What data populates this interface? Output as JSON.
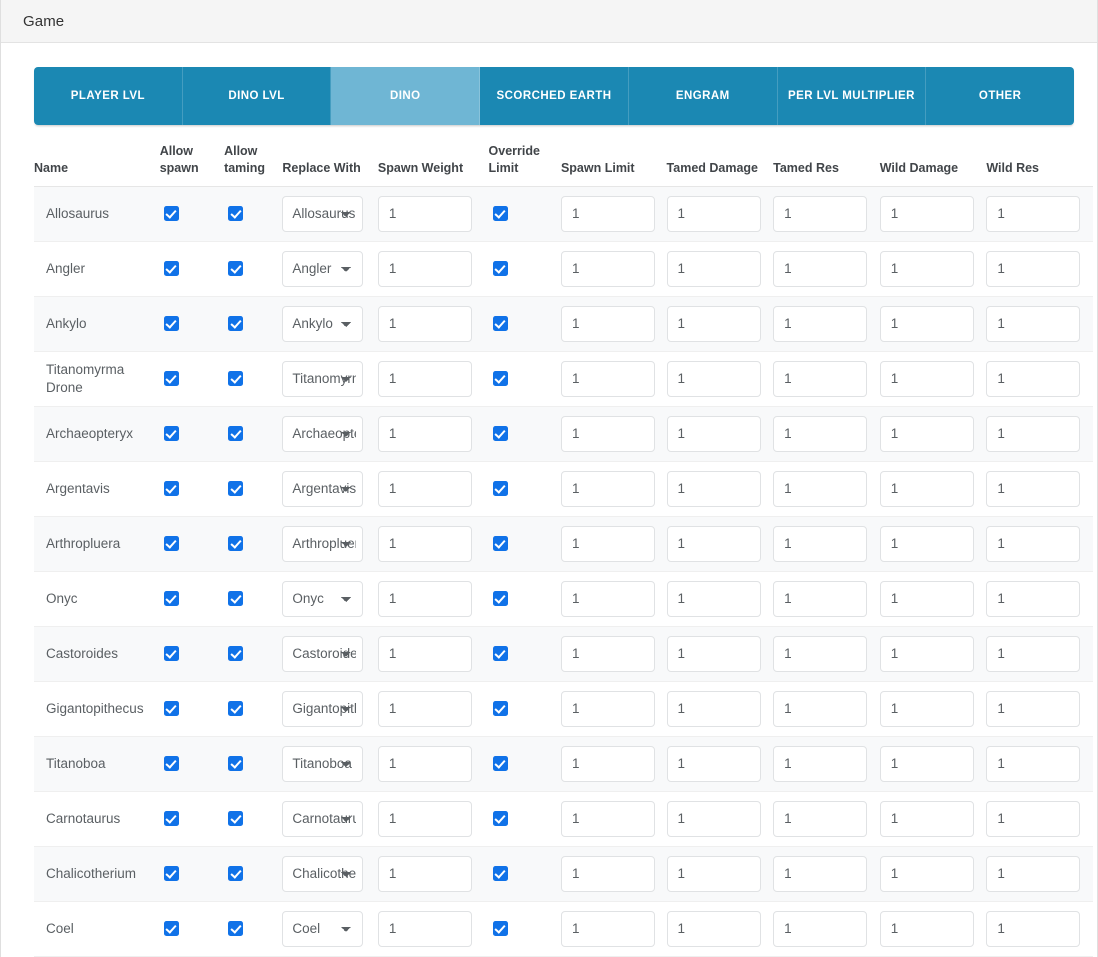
{
  "header": {
    "title": "Game"
  },
  "tabs": [
    {
      "label": "PLAYER LVL",
      "active": false
    },
    {
      "label": "DINO LVL",
      "active": false
    },
    {
      "label": "DINO",
      "active": true
    },
    {
      "label": "SCORCHED EARTH",
      "active": false
    },
    {
      "label": "ENGRAM",
      "active": false
    },
    {
      "label": "PER LVL MULTIPLIER",
      "active": false
    },
    {
      "label": "OTHER",
      "active": false
    }
  ],
  "table": {
    "columns": [
      "Name",
      "Allow spawn",
      "Allow taming",
      "Replace With",
      "Spawn Weight",
      "Override Limit",
      "Spawn Limit",
      "Tamed Damage",
      "Tamed Res",
      "Wild Damage",
      "Wild Res"
    ],
    "rows": [
      {
        "name": "Allosaurus",
        "allow_spawn": true,
        "allow_taming": true,
        "replace_with": "Allosaurus",
        "spawn_weight": "1",
        "override_limit": true,
        "spawn_limit": "1",
        "tamed_damage": "1",
        "tamed_res": "1",
        "wild_damage": "1",
        "wild_res": "1"
      },
      {
        "name": "Angler",
        "allow_spawn": true,
        "allow_taming": true,
        "replace_with": "Angler",
        "spawn_weight": "1",
        "override_limit": true,
        "spawn_limit": "1",
        "tamed_damage": "1",
        "tamed_res": "1",
        "wild_damage": "1",
        "wild_res": "1"
      },
      {
        "name": "Ankylo",
        "allow_spawn": true,
        "allow_taming": true,
        "replace_with": "Ankylo",
        "spawn_weight": "1",
        "override_limit": true,
        "spawn_limit": "1",
        "tamed_damage": "1",
        "tamed_res": "1",
        "wild_damage": "1",
        "wild_res": "1"
      },
      {
        "name": "Titanomyrma Drone",
        "allow_spawn": true,
        "allow_taming": true,
        "replace_with": "Titanomyrma Drone",
        "spawn_weight": "1",
        "override_limit": true,
        "spawn_limit": "1",
        "tamed_damage": "1",
        "tamed_res": "1",
        "wild_damage": "1",
        "wild_res": "1"
      },
      {
        "name": "Archaeopteryx",
        "allow_spawn": true,
        "allow_taming": true,
        "replace_with": "Archaeopteryx",
        "spawn_weight": "1",
        "override_limit": true,
        "spawn_limit": "1",
        "tamed_damage": "1",
        "tamed_res": "1",
        "wild_damage": "1",
        "wild_res": "1"
      },
      {
        "name": "Argentavis",
        "allow_spawn": true,
        "allow_taming": true,
        "replace_with": "Argentavis",
        "spawn_weight": "1",
        "override_limit": true,
        "spawn_limit": "1",
        "tamed_damage": "1",
        "tamed_res": "1",
        "wild_damage": "1",
        "wild_res": "1"
      },
      {
        "name": "Arthropluera",
        "allow_spawn": true,
        "allow_taming": true,
        "replace_with": "Arthropluera",
        "spawn_weight": "1",
        "override_limit": true,
        "spawn_limit": "1",
        "tamed_damage": "1",
        "tamed_res": "1",
        "wild_damage": "1",
        "wild_res": "1"
      },
      {
        "name": "Onyc",
        "allow_spawn": true,
        "allow_taming": true,
        "replace_with": "Onyc",
        "spawn_weight": "1",
        "override_limit": true,
        "spawn_limit": "1",
        "tamed_damage": "1",
        "tamed_res": "1",
        "wild_damage": "1",
        "wild_res": "1"
      },
      {
        "name": "Castoroides",
        "allow_spawn": true,
        "allow_taming": true,
        "replace_with": "Castoroides",
        "spawn_weight": "1",
        "override_limit": true,
        "spawn_limit": "1",
        "tamed_damage": "1",
        "tamed_res": "1",
        "wild_damage": "1",
        "wild_res": "1"
      },
      {
        "name": "Gigantopithecus",
        "allow_spawn": true,
        "allow_taming": true,
        "replace_with": "Gigantopithecus",
        "spawn_weight": "1",
        "override_limit": true,
        "spawn_limit": "1",
        "tamed_damage": "1",
        "tamed_res": "1",
        "wild_damage": "1",
        "wild_res": "1"
      },
      {
        "name": "Titanoboa",
        "allow_spawn": true,
        "allow_taming": true,
        "replace_with": "Titanoboa",
        "spawn_weight": "1",
        "override_limit": true,
        "spawn_limit": "1",
        "tamed_damage": "1",
        "tamed_res": "1",
        "wild_damage": "1",
        "wild_res": "1"
      },
      {
        "name": "Carnotaurus",
        "allow_spawn": true,
        "allow_taming": true,
        "replace_with": "Carnotaurus",
        "spawn_weight": "1",
        "override_limit": true,
        "spawn_limit": "1",
        "tamed_damage": "1",
        "tamed_res": "1",
        "wild_damage": "1",
        "wild_res": "1"
      },
      {
        "name": "Chalicotherium",
        "allow_spawn": true,
        "allow_taming": true,
        "replace_with": "Chalicotherium",
        "spawn_weight": "1",
        "override_limit": true,
        "spawn_limit": "1",
        "tamed_damage": "1",
        "tamed_res": "1",
        "wild_damage": "1",
        "wild_res": "1"
      },
      {
        "name": "Coel",
        "allow_spawn": true,
        "allow_taming": true,
        "replace_with": "Coel",
        "spawn_weight": "1",
        "override_limit": true,
        "spawn_limit": "1",
        "tamed_damage": "1",
        "tamed_res": "1",
        "wild_damage": "1",
        "wild_res": "1"
      }
    ]
  },
  "colors": {
    "tab_inactive": "#1b88b3",
    "tab_active": "#6fb6d4",
    "checkbox_checked": "#1072e8",
    "row_stripe": "#f8f9fa",
    "header_bg": "#f5f5f5"
  }
}
